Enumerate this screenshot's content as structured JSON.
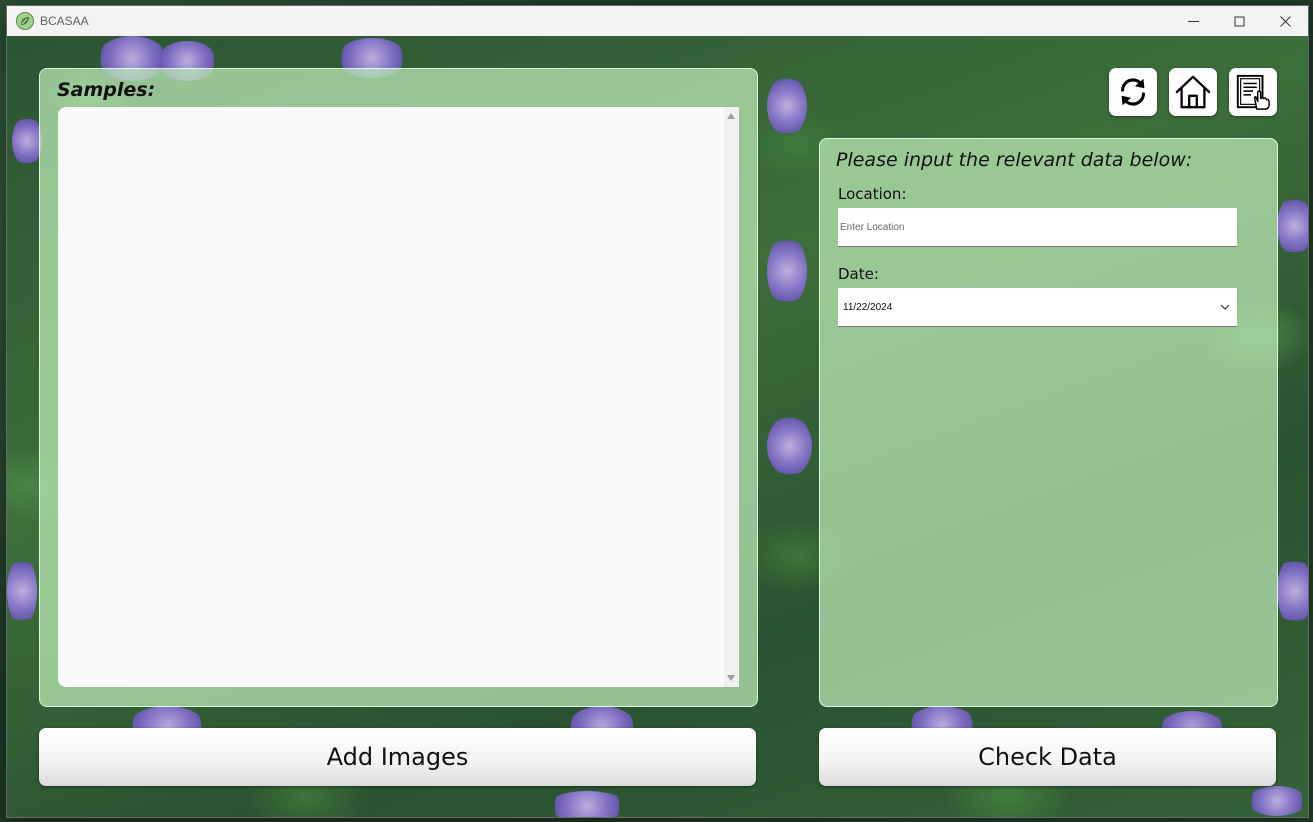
{
  "window": {
    "title": "BCASAA",
    "controls": [
      "minimize",
      "maximize",
      "close"
    ]
  },
  "samples": {
    "title": "Samples:",
    "items": []
  },
  "toolbar": {
    "icons": [
      "refresh-icon",
      "home-icon",
      "records-icon"
    ]
  },
  "form": {
    "heading": "Please input the relevant data below:",
    "location": {
      "label": "Location:",
      "placeholder": "Enter Location",
      "value": ""
    },
    "date": {
      "label": "Date:",
      "value": "11/22/2024"
    }
  },
  "buttons": {
    "add_images": "Add Images",
    "check_data": "Check Data"
  }
}
